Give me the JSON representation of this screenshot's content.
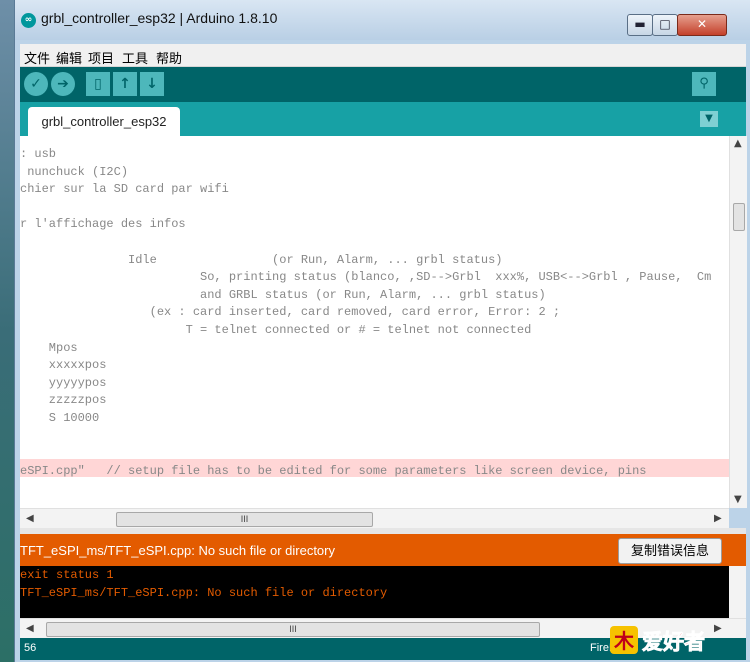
{
  "window": {
    "title": "grbl_controller_esp32 | Arduino 1.8.10",
    "minimize": "▬",
    "maximize": "□",
    "close": "✕"
  },
  "menu": [
    "文件",
    "编辑",
    "项目",
    "工具",
    "帮助"
  ],
  "toolbar": {
    "verify": "✓",
    "upload": "➔",
    "new": "▯",
    "open": "↑",
    "save": "↓",
    "serial_monitor": "⚲"
  },
  "tab": {
    "label": "grbl_controller_esp32",
    "menu": "▼"
  },
  "editor": {
    "lines": [
      ": usb",
      " nunchuck (I2C)",
      "chier sur la SD card par wifi",
      "",
      "r l'affichage des infos",
      "",
      "               Idle                (or Run, Alarm, ... grbl status)",
      "                         So, printing status (blanco, ,SD-->Grbl  xxx%, USB<-->Grbl , Pause,  Cm",
      "                         and GRBL status (or Run, Alarm, ... grbl status)",
      "                  (ex : card inserted, card removed, card error, Error: 2 ;",
      "                       T = telnet connected or # = telnet not connected",
      "    Mpos",
      "    xxxxxpos",
      "    yyyyypos",
      "    zzzzzpos",
      "    S 10000",
      "",
      "",
      "eSPI.cpp\"   // setup file has to be edited for some parameters like screen device, pins"
    ]
  },
  "scrollbar": {
    "grip": "III",
    "up": "▲",
    "down": "▼",
    "left": "◀",
    "right": "▶"
  },
  "status": {
    "message": "TFT_eSPI_ms/TFT_eSPI.cpp: No such file or directory",
    "copy_button": "复制错误信息"
  },
  "console": {
    "lines": [
      "exit status 1",
      "TFT_eSPI_ms/TFT_eSPI.cpp: No such file or directory"
    ]
  },
  "bottom": {
    "line_number": "56",
    "board": "FireBe"
  },
  "watermark": {
    "text": "爱好者",
    "logo": "木"
  },
  "colors": {
    "teal_dark": "#006468",
    "teal": "#17a1a5",
    "error": "#e35b00"
  }
}
